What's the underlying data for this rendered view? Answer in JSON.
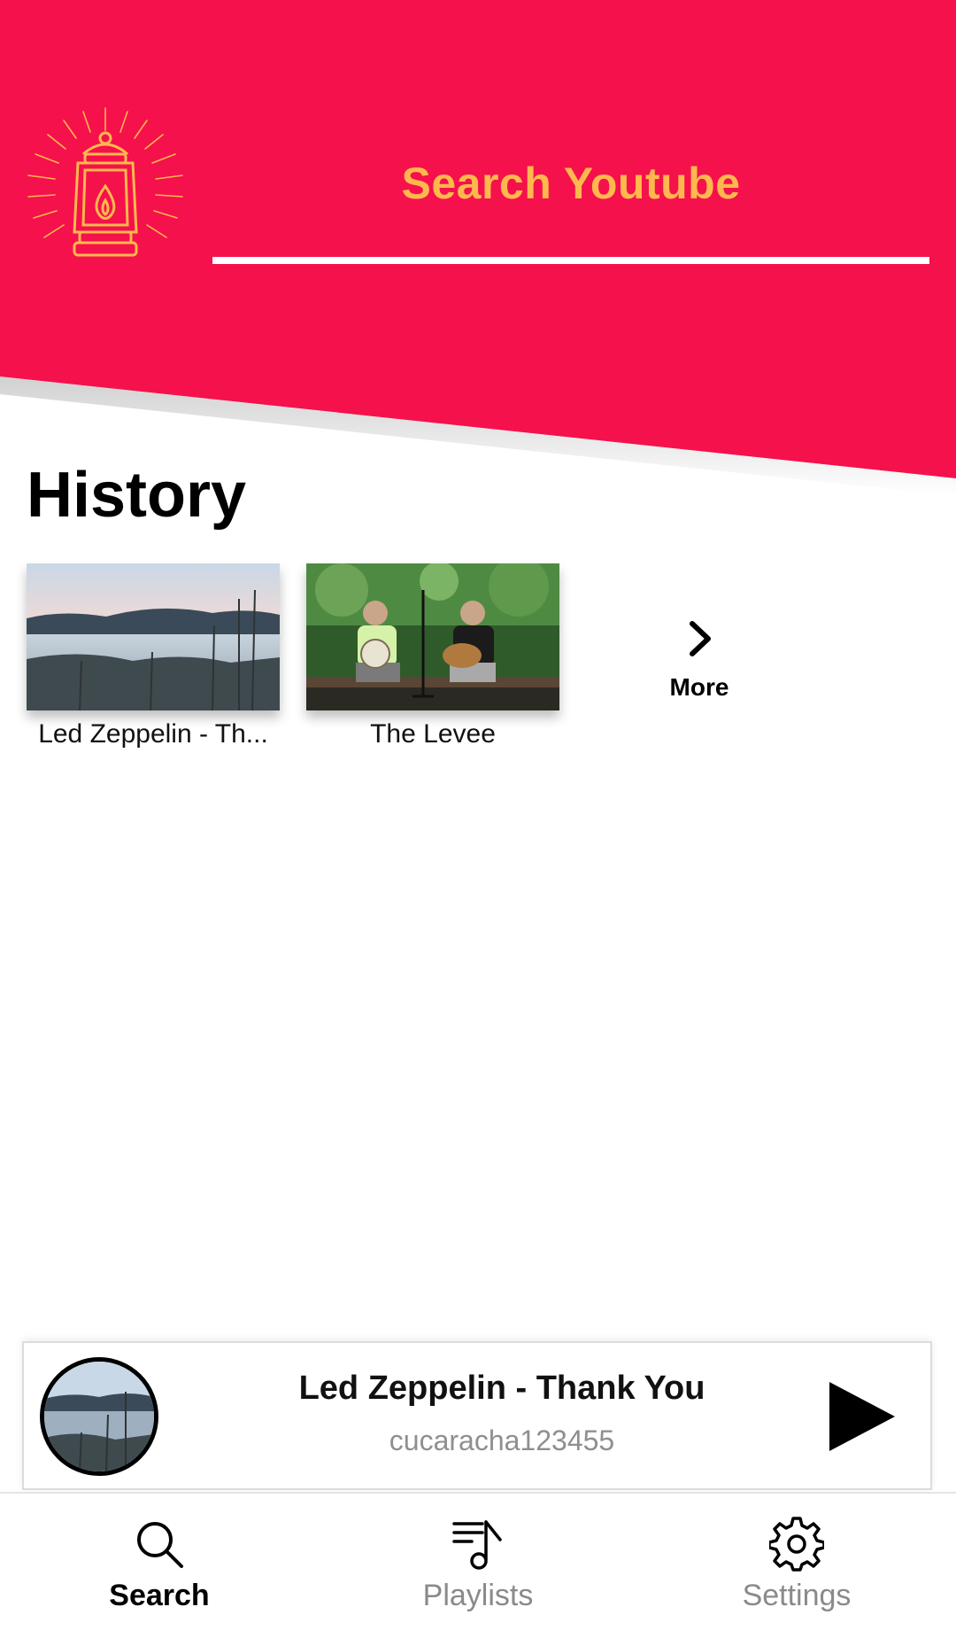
{
  "colors": {
    "header_bg": "#F5114C",
    "accent": "#FFB84D",
    "text": "#000000",
    "muted": "#8A8A8A"
  },
  "header": {
    "logo_icon": "lantern-icon",
    "search_label": "Search Youtube"
  },
  "history": {
    "title": "History",
    "items": [
      {
        "title": "Led Zeppelin - Th...",
        "thumb": "lake-landscape"
      },
      {
        "title": "The Levee",
        "thumb": "musicians-outdoors"
      }
    ],
    "more_label": "More"
  },
  "now_playing": {
    "title": "Led Zeppelin - Thank You",
    "artist": "cucaracha123455",
    "play_icon": "play-icon"
  },
  "nav": {
    "items": [
      {
        "label": "Search",
        "icon": "search-icon",
        "active": true
      },
      {
        "label": "Playlists",
        "icon": "playlist-icon",
        "active": false
      },
      {
        "label": "Settings",
        "icon": "gear-icon",
        "active": false
      }
    ]
  }
}
